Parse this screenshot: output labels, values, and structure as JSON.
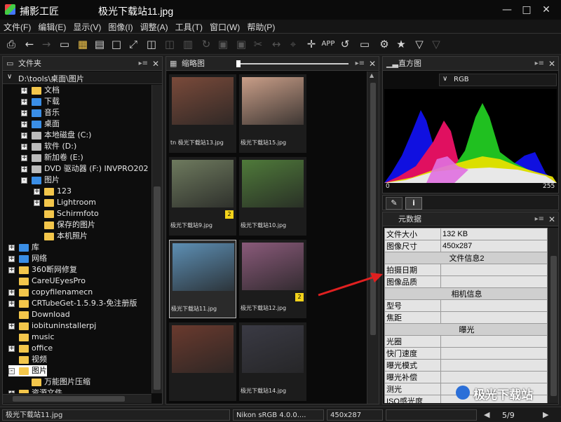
{
  "window": {
    "app": "捕影工匠",
    "file": "极光下载站11.jpg"
  },
  "menu": [
    "文件(F)",
    "编辑(E)",
    "显示(V)",
    "图像(I)",
    "调整(A)",
    "工具(T)",
    "窗口(W)",
    "帮助(P)"
  ],
  "folders": {
    "title": "文件夹",
    "path": "D:\\tools\\桌面\\图片",
    "items": [
      {
        "label": "文档",
        "level": 1,
        "exp": "+",
        "icon": "document"
      },
      {
        "label": "下载",
        "level": 1,
        "exp": "+",
        "icon": "download"
      },
      {
        "label": "音乐",
        "level": 1,
        "exp": "+",
        "icon": "music"
      },
      {
        "label": "桌面",
        "level": 1,
        "exp": "+",
        "icon": "desktop"
      },
      {
        "label": "本地磁盘 (C:)",
        "level": 1,
        "exp": "+",
        "icon": "drive"
      },
      {
        "label": "软件 (D:)",
        "level": 1,
        "exp": "+",
        "icon": "drive"
      },
      {
        "label": "新加卷 (E:)",
        "level": 1,
        "exp": "+",
        "icon": "drive"
      },
      {
        "label": "DVD 驱动器 (F:) INVPRO202",
        "level": 1,
        "exp": "+",
        "icon": "disc"
      },
      {
        "label": "图片",
        "level": 1,
        "exp": "-",
        "icon": "pictures"
      },
      {
        "label": "123",
        "level": 2,
        "exp": "+",
        "icon": "folder"
      },
      {
        "label": "Lightroom",
        "level": 2,
        "exp": "+",
        "icon": "folder"
      },
      {
        "label": "Schirmfoto",
        "level": 2,
        "exp": "",
        "icon": "folder"
      },
      {
        "label": "保存的图片",
        "level": 2,
        "exp": "",
        "icon": "folder"
      },
      {
        "label": "本机照片",
        "level": 2,
        "exp": "",
        "icon": "folder"
      },
      {
        "label": "库",
        "level": 0,
        "exp": "+",
        "icon": "library"
      },
      {
        "label": "网络",
        "level": 0,
        "exp": "+",
        "icon": "network"
      },
      {
        "label": "360断网修复",
        "level": 0,
        "exp": "+",
        "icon": "folder"
      },
      {
        "label": "CareUEyesPro",
        "level": 0,
        "exp": "",
        "icon": "folder"
      },
      {
        "label": "copyfilenamecn",
        "level": 0,
        "exp": "+",
        "icon": "folder"
      },
      {
        "label": "CRTubeGet-1.5.9.3-免注册版",
        "level": 0,
        "exp": "+",
        "icon": "folder"
      },
      {
        "label": "Download",
        "level": 0,
        "exp": "",
        "icon": "folder"
      },
      {
        "label": "iobituninstallerpj",
        "level": 0,
        "exp": "+",
        "icon": "folder"
      },
      {
        "label": "music",
        "level": 0,
        "exp": "",
        "icon": "folder"
      },
      {
        "label": "office",
        "level": 0,
        "exp": "+",
        "icon": "folder"
      },
      {
        "label": "视频",
        "level": 0,
        "exp": "",
        "icon": "folder"
      },
      {
        "label": "图片",
        "level": 0,
        "exp": "-",
        "icon": "folder",
        "selected": true
      },
      {
        "label": "万能图片压缩",
        "level": 1,
        "exp": "",
        "icon": "folder"
      },
      {
        "label": "资源文件",
        "level": 0,
        "exp": "+",
        "icon": "folder"
      }
    ]
  },
  "thumbs": {
    "title": "缩略图",
    "items": [
      {
        "cap": "tn 极光下载站13.jpg",
        "color": "#7a4a3a",
        "star": ""
      },
      {
        "cap": "极光下载站15.jpg",
        "color": "#c99e88",
        "star": ""
      },
      {
        "cap": "极光下载站9.jpg",
        "color": "#6e7a5e",
        "star": "2"
      },
      {
        "cap": "极光下载站10.jpg",
        "color": "#4f7a3a",
        "star": ""
      },
      {
        "cap": "极光下载站11.jpg",
        "color": "#5d8fb4",
        "star": "",
        "selected": true
      },
      {
        "cap": "极光下载站12.jpg",
        "color": "#8a5a7a",
        "star": "2"
      },
      {
        "cap": "",
        "color": "#6a3a2e",
        "star": ""
      },
      {
        "cap": "极光下载站14.jpg",
        "color": "#3a3a44",
        "star": ""
      }
    ]
  },
  "histogram": {
    "title": "直方图",
    "channel": "RGB",
    "min": "0",
    "max": "255"
  },
  "meta": {
    "title": "元数据",
    "rows": [
      {
        "k": "文件大小",
        "v": "132 KB"
      },
      {
        "k": "图像尺寸",
        "v": "450x287"
      },
      {
        "section": "文件信息2"
      },
      {
        "k": "拍摄日期",
        "v": ""
      },
      {
        "k": "图像品质",
        "v": ""
      },
      {
        "section": "相机信息"
      },
      {
        "k": "型号",
        "v": ""
      },
      {
        "k": "焦距",
        "v": ""
      },
      {
        "section": "曝光"
      },
      {
        "k": "光圈",
        "v": ""
      },
      {
        "k": "快门速度",
        "v": ""
      },
      {
        "k": "曝光模式",
        "v": ""
      },
      {
        "k": "曝光补偿",
        "v": ""
      },
      {
        "k": "测光",
        "v": ""
      },
      {
        "k": "ISO感光度",
        "v": ""
      }
    ]
  },
  "status": {
    "file": "极光下载站11.jpg",
    "profile": "Nikon sRGB 4.0.0....",
    "dims": "450x287",
    "page": "5/9"
  },
  "watermark": "极光下载站",
  "colors": {
    "accent": "#f3c64b",
    "arrow": "#e02020"
  }
}
